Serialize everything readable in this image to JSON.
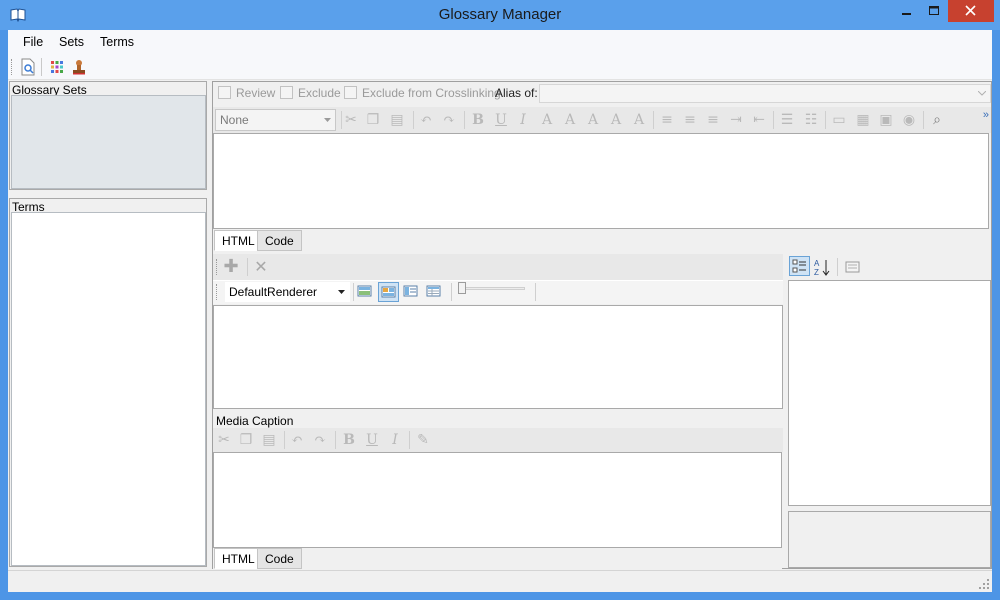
{
  "window": {
    "title": "Glossary Manager"
  },
  "menu": {
    "file": "File",
    "sets": "Sets",
    "terms": "Terms"
  },
  "panels": {
    "glossary_sets": "Glossary Sets",
    "terms": "Terms"
  },
  "term_options": {
    "review": "Review",
    "exclude": "Exclude",
    "exclude_crosslinking": "Exclude from Crosslinking",
    "alias_of": "Alias of:",
    "alias_value": ""
  },
  "format_toolbar": {
    "style_value": "None",
    "bold": "B",
    "underline": "U",
    "italic": "I",
    "overflow": "»"
  },
  "editor_tabs": {
    "html": "HTML",
    "code": "Code"
  },
  "media": {
    "renderer_value": "DefaultRenderer",
    "caption_label": "Media Caption"
  },
  "caption_tabs": {
    "html": "HTML",
    "code": "Code"
  },
  "colors": {
    "titlebar": "#5aa0eb",
    "close": "#c7412f",
    "accent": "#3a6fb8"
  }
}
